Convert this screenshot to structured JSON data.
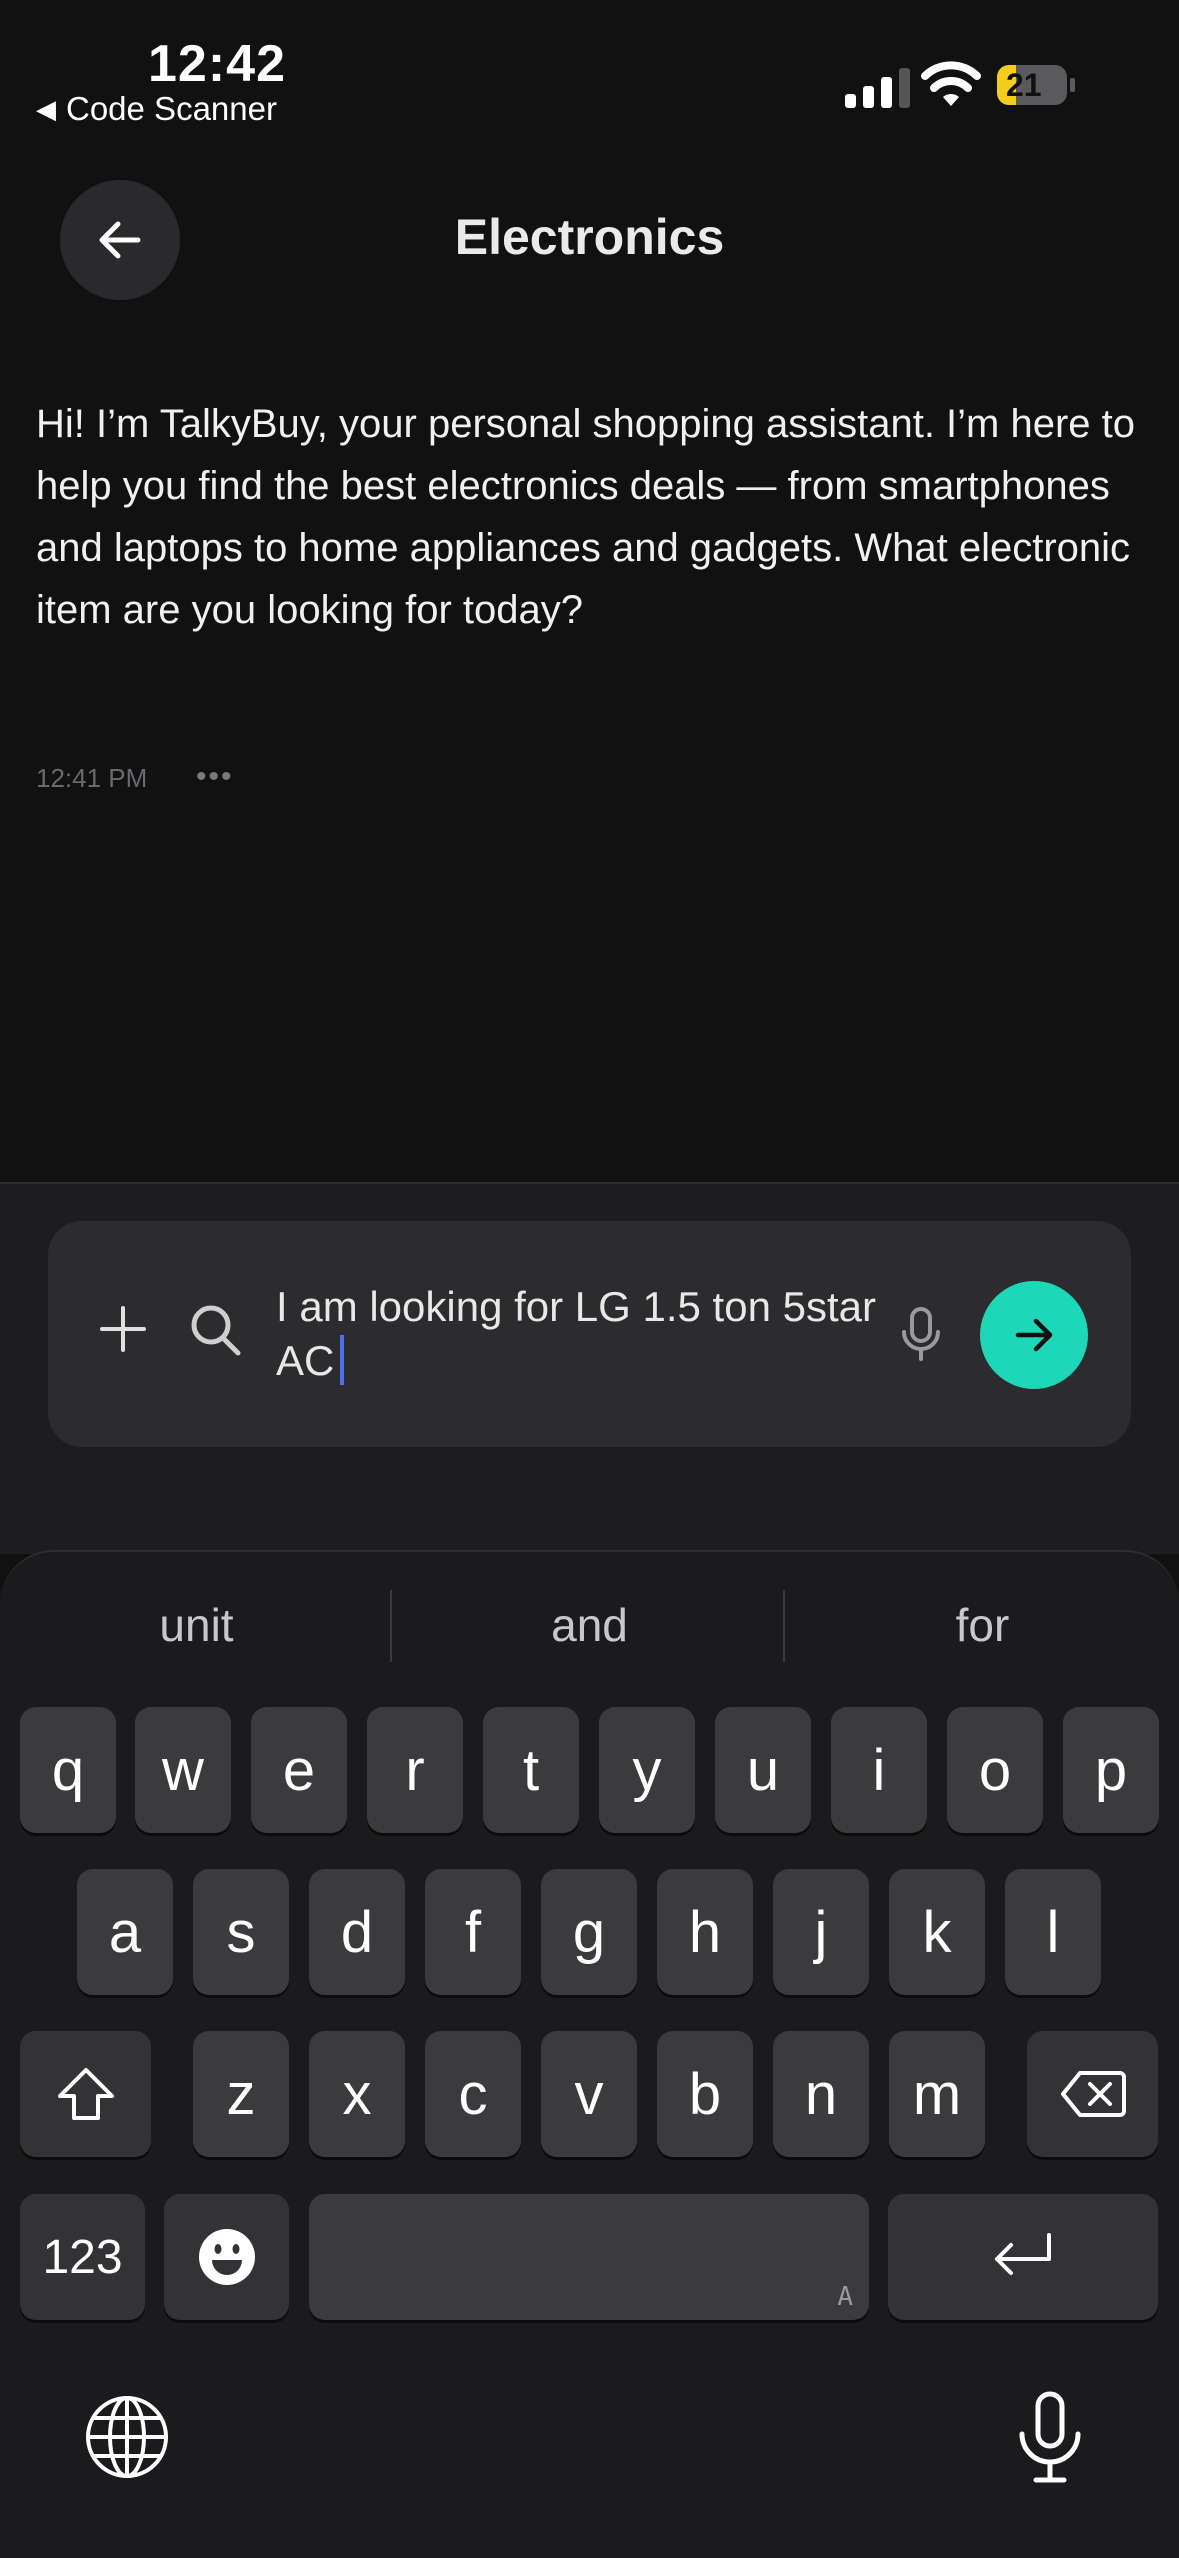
{
  "status_bar": {
    "time": "12:42",
    "back_app": "Code Scanner",
    "battery": "21"
  },
  "header": {
    "title": "Electronics"
  },
  "chat": {
    "message": "Hi! I’m TalkyBuy, your personal shopping assistant. I’m here to help you find the best electronics deals — from smartphones and laptops to home appliances and gadgets. What electronic item are you looking for today?",
    "timestamp": "12:41 PM",
    "more": "•••"
  },
  "composer": {
    "value": "I am looking for LG 1.5 ton 5star AC"
  },
  "keyboard": {
    "suggestions": [
      "unit",
      "and",
      "for"
    ],
    "row1": [
      "q",
      "w",
      "e",
      "r",
      "t",
      "y",
      "u",
      "i",
      "o",
      "p"
    ],
    "row2": [
      "a",
      "s",
      "d",
      "f",
      "g",
      "h",
      "j",
      "k",
      "l"
    ],
    "row3": [
      "z",
      "x",
      "c",
      "v",
      "b",
      "n",
      "m"
    ],
    "numbers_label": "123",
    "space_hint": "A"
  },
  "colors": {
    "background": "#111112",
    "accent": "#1ed6b8",
    "caret": "#4f6ef0"
  }
}
